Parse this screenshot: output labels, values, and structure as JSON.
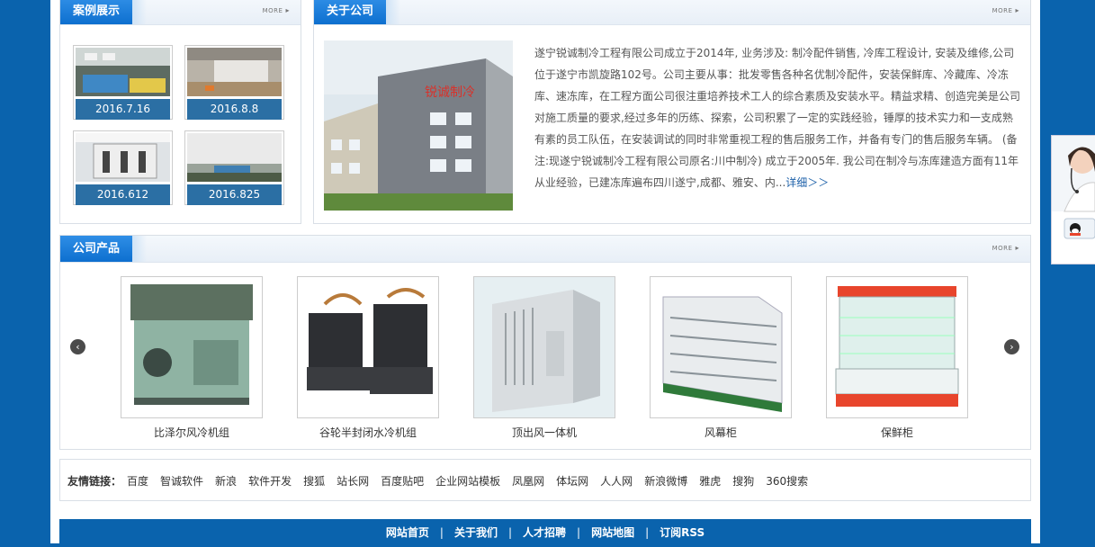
{
  "cases": {
    "title": "案例展示",
    "more": "MORE",
    "items": [
      {
        "caption": "2016.7.16"
      },
      {
        "caption": "2016.8.8"
      },
      {
        "caption": "2016.612"
      },
      {
        "caption": "2016.825"
      }
    ]
  },
  "about": {
    "title": "关于公司",
    "more": "MORE",
    "photo_sign": "锐诚制冷",
    "text": "遂宁锐诚制冷工程有限公司成立于2014年, 业务涉及: 制冷配件销售, 冷库工程设计, 安装及维修,公司位于遂宁市凯旋路102号。公司主要从事：批发零售各种名优制冷配件，安装保鲜库、冷藏库、冷冻库、速冻库，在工程方面公司很注重培养技术工人的综合素质及安装水平。精益求精、创造完美是公司对施工质量的要求,经过多年的历练、探索，公司积累了一定的实践经验，锤厚的技术实力和一支成熟有素的员工队伍，在安装调试的同时非常重视工程的售后服务工作，并备有专门的售后服务车辆。 (备注:现遂宁锐诚制冷工程有限公司原名:川中制冷) 成立于2005年. 我公司在制冷与冻库建造方面有11年从业经验，已建冻库遍布四川遂宁,成都、雅安、内...",
    "more_link": "详细＞＞"
  },
  "products": {
    "title": "公司产品",
    "more": "MORE",
    "prev": "‹",
    "next": "›",
    "items": [
      {
        "name": "比泽尔风冷机组"
      },
      {
        "name": "谷轮半封闭水冷机组"
      },
      {
        "name": "顶出风一体机"
      },
      {
        "name": "风幕柜"
      },
      {
        "name": "保鲜柜"
      }
    ]
  },
  "links": {
    "label": "友情链接：",
    "items": [
      "百度",
      "智诚软件",
      "新浪",
      "软件开发",
      "搜狐",
      "站长网",
      "百度贴吧",
      "企业网站模板",
      "凤凰网",
      "体坛网",
      "人人网",
      "新浪微博",
      "雅虎",
      "搜狗",
      "360搜索"
    ]
  },
  "footer": {
    "items": [
      "网站首页",
      "关于我们",
      "人才招聘",
      "网站地图",
      "订阅RSS"
    ],
    "separator": "|"
  },
  "colors": {
    "page_bg": "#0a63ad",
    "accent": "#0d6fcf"
  }
}
